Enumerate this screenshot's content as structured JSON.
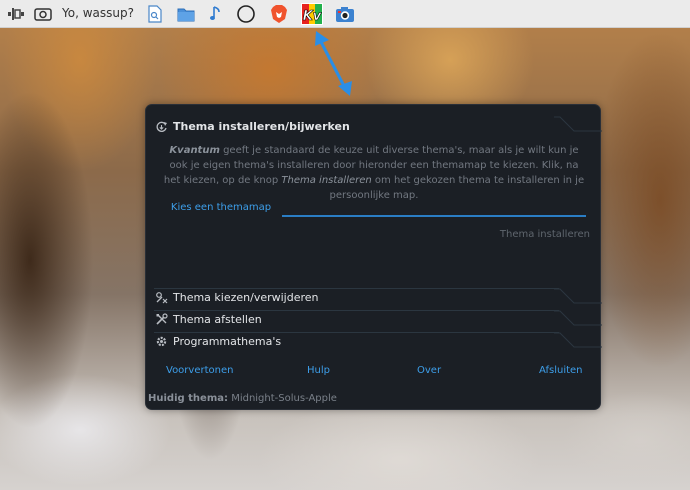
{
  "panel": {
    "window_title": "Yo, wassup?",
    "icons": [
      "system-settings-icon",
      "screenshot-icon",
      "document-viewer-icon",
      "folder-icon",
      "music-icon",
      "circle-icon",
      "brave-browser-icon",
      "kvantum-manager-icon",
      "camera-icon"
    ],
    "kvantum_logo_text": "Kv"
  },
  "dialog": {
    "install_section": {
      "title": "Thema installeren/bijwerken",
      "desc_brand": "Kvantum",
      "desc_part1": " geeft je standaard de keuze uit diverse thema's, maar als je wilt kun je ook je eigen thema's installeren door hieronder een themamap te kiezen. Klik, na het kiezen, op de knop ",
      "desc_emph": "Thema installeren",
      "desc_part2": " om het gekozen thema te installeren in je persoonlijke map.",
      "choose_folder": "Kies een themamap",
      "install_button": "Thema installeren"
    },
    "sections": [
      {
        "label": "Thema kiezen/verwijderen",
        "icon": "theme-select-icon"
      },
      {
        "label": "Thema afstellen",
        "icon": "tools-icon"
      },
      {
        "label": "Programmathema's",
        "icon": "gear-icon"
      }
    ],
    "buttons": {
      "preview": "Voorvertonen",
      "help": "Hulp",
      "about": "Over",
      "quit": "Afsluiten"
    },
    "current_theme_label": "Huidig thema:",
    "current_theme_value": "Midnight-Solus-Apple"
  },
  "colors": {
    "dialog_bg": "#1b1f25",
    "accent": "#3d9ee9",
    "arrow": "#2a8ee6"
  }
}
